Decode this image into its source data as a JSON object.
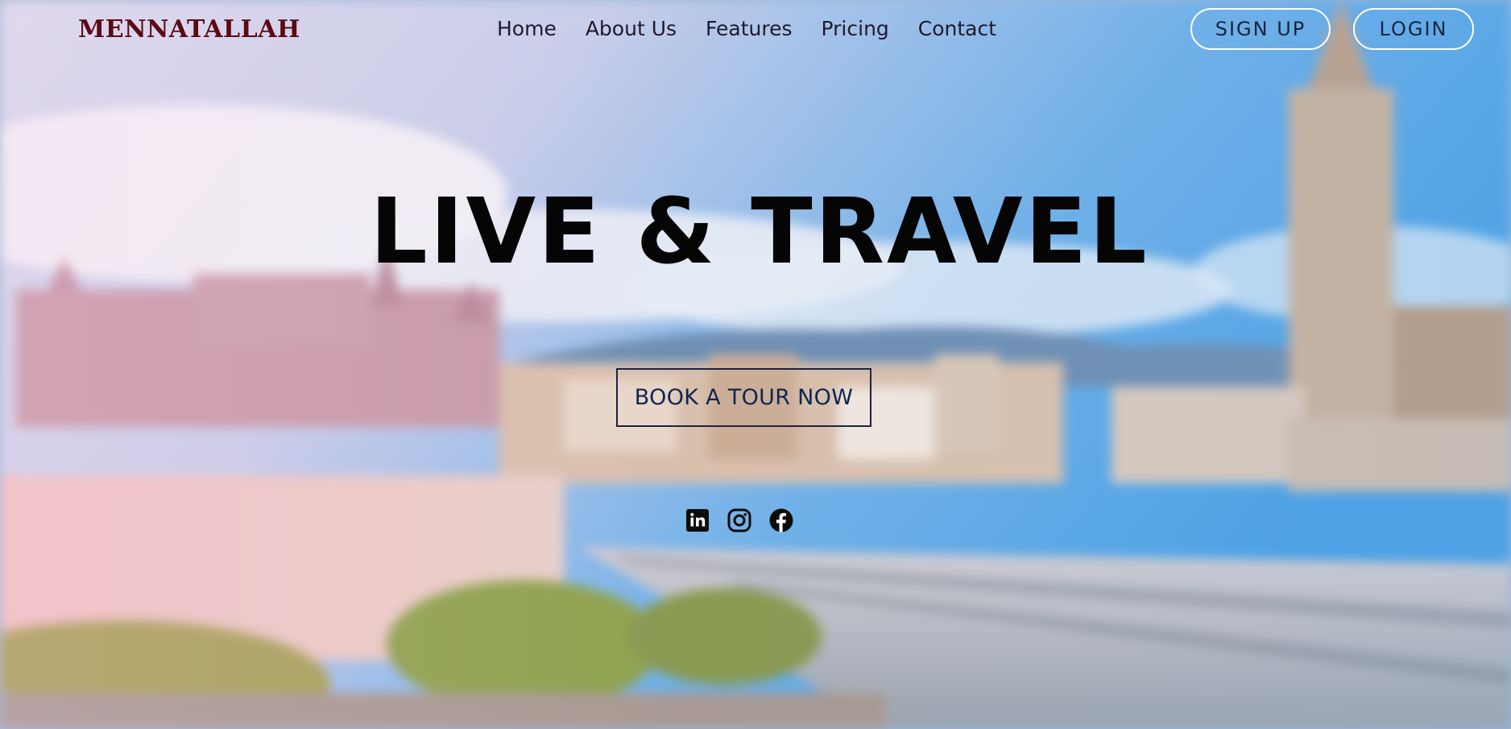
{
  "brand": {
    "name": "MENNATALLAH"
  },
  "nav": {
    "links": [
      {
        "label": "Home"
      },
      {
        "label": "About Us"
      },
      {
        "label": "Features"
      },
      {
        "label": "Pricing"
      },
      {
        "label": "Contact"
      }
    ]
  },
  "auth": {
    "signup_label": "SIGN UP",
    "login_label": "LOGIN"
  },
  "hero": {
    "headline": "LIVE & TRAVEL",
    "cta_label": "BOOK A TOUR NOW",
    "background": "blurred-city-rooftop-photo"
  },
  "social": {
    "icons": [
      "linkedin-icon",
      "instagram-icon",
      "facebook-icon"
    ]
  },
  "colors": {
    "brand": "#5a0a12",
    "nav_text": "#1f1a2e",
    "cta_text": "#10264f",
    "auth_border": "#ffffff",
    "headline": "#050505"
  }
}
